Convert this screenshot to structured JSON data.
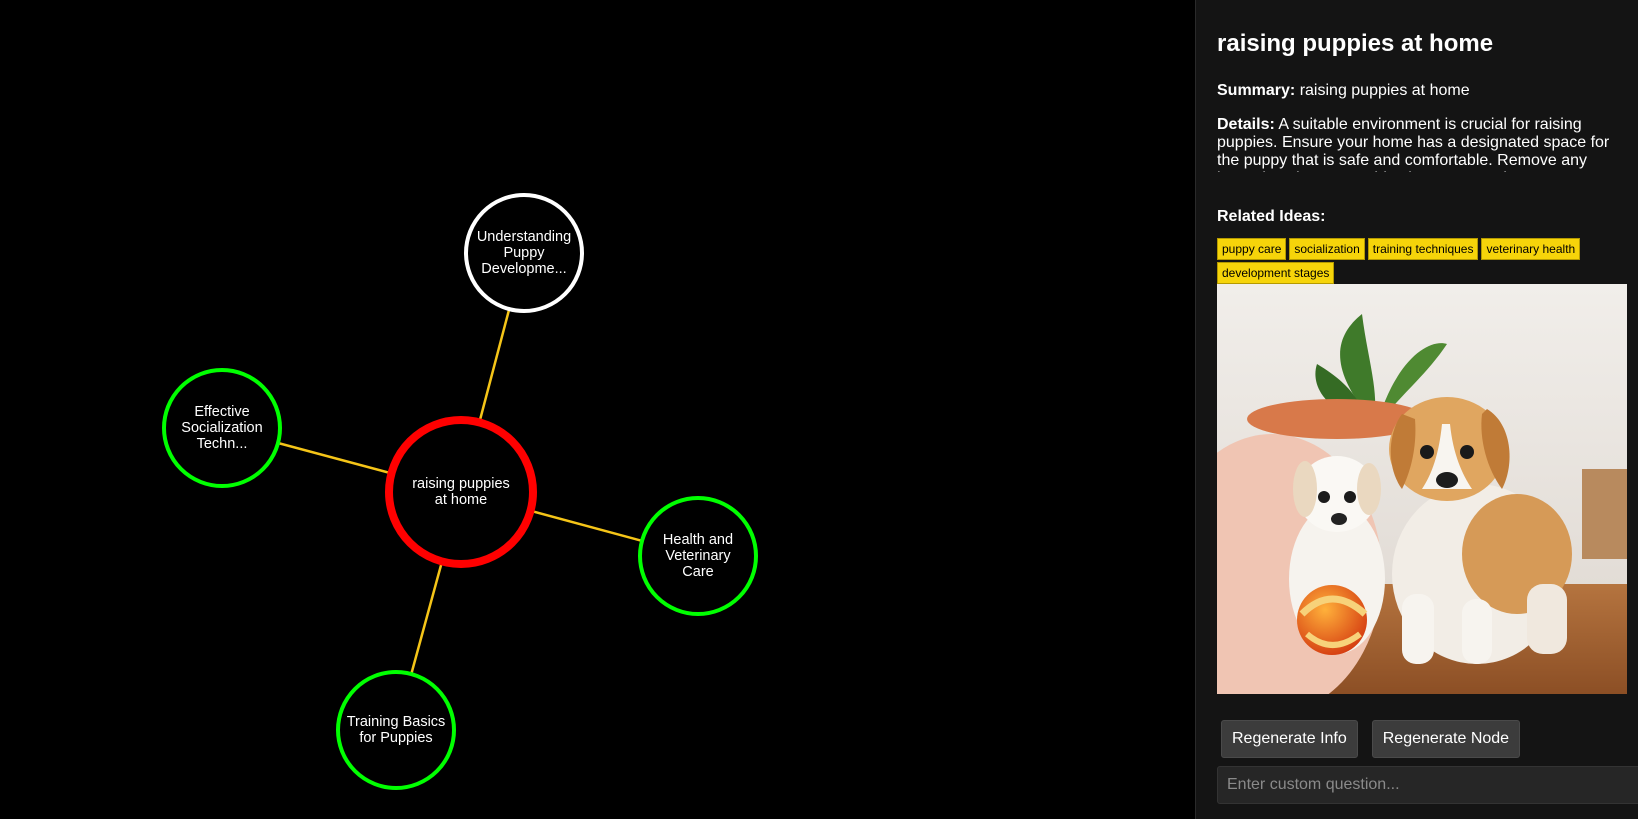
{
  "graph": {
    "nodes": [
      {
        "id": "center",
        "label": "raising puppies at home",
        "color": "#ff0000",
        "role": "selected"
      },
      {
        "id": "dev",
        "label": "Understanding Puppy Developme...",
        "color": "#ffffff",
        "role": "node"
      },
      {
        "id": "social",
        "label": "Effective Socialization Techn...",
        "color": "#00ff00",
        "role": "node"
      },
      {
        "id": "health",
        "label": "Health and Veterinary Care",
        "color": "#00ff00",
        "role": "node"
      },
      {
        "id": "training",
        "label": "Training Basics for Puppies",
        "color": "#00ff00",
        "role": "node"
      }
    ],
    "edges": [
      {
        "from": "center",
        "to": "dev"
      },
      {
        "from": "center",
        "to": "social"
      },
      {
        "from": "center",
        "to": "health"
      },
      {
        "from": "center",
        "to": "training"
      }
    ],
    "edge_color": "#f5c518"
  },
  "panel": {
    "title": "raising puppies at home",
    "summary_label": "Summary:",
    "summary": "raising puppies at home",
    "details_label": "Details:",
    "details": "A suitable environment is crucial for raising puppies. Ensure your home has a designated space for the puppy that is safe and comfortable. Remove any hazardous items, provide chew toys, and set up a crate or bed.",
    "related_heading": "Related Ideas:",
    "tags": [
      "puppy care",
      "socialization",
      "training techniques",
      "veterinary health",
      "development stages"
    ],
    "tag_color": "#f6d40a",
    "regenerate_info_label": "Regenerate Info",
    "regenerate_node_label": "Regenerate Node",
    "question_placeholder": "Enter custom question..."
  }
}
